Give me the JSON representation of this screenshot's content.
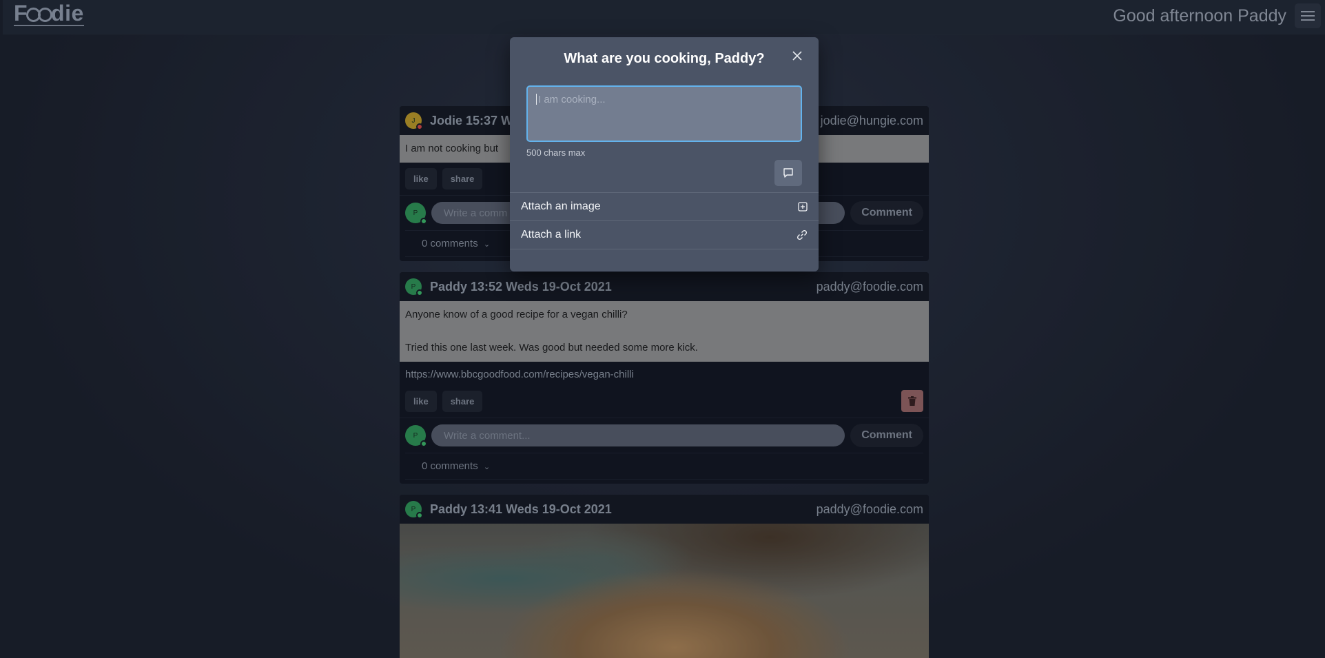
{
  "navbar": {
    "logo_text_start": "F",
    "logo_text_end": "die",
    "greeting": "Good afternoon Paddy"
  },
  "posts": [
    {
      "avatar_initial": "J",
      "avatar_color": "#c9a227",
      "status_color": "#e04848",
      "author_line": "Jodie 15:37 We",
      "email": "jodie@hungie.com",
      "body": "I am not cooking but",
      "like_label": "like",
      "share_label": "share",
      "commenter_initial": "P",
      "comment_placeholder": "Write a comm",
      "comment_button": "Comment",
      "comments_count": "0 comments"
    },
    {
      "avatar_initial": "P",
      "avatar_color": "#2f9e5a",
      "status_color": "#3fc46f",
      "author_line": "Paddy 13:52 Weds 19-Oct 2021",
      "email": "paddy@foodie.com",
      "body_line1": "Anyone know of a good recipe for a vegan chilli?",
      "body_line2": "Tried this one last week. Was good but needed some more kick.",
      "link": "https://www.bbcgoodfood.com/recipes/vegan-chilli",
      "like_label": "like",
      "share_label": "share",
      "commenter_initial": "P",
      "comment_placeholder": "Write a comment...",
      "comment_button": "Comment",
      "comments_count": "0 comments"
    },
    {
      "avatar_initial": "P",
      "avatar_color": "#2f9e5a",
      "status_color": "#3fc46f",
      "author_line": "Paddy 13:41 Weds 19-Oct 2021",
      "email": "paddy@foodie.com"
    }
  ],
  "modal": {
    "title": "What are you cooking, Paddy?",
    "textarea_placeholder": "I am cooking...",
    "chars_max": "500 chars max",
    "attach_image_label": "Attach an image",
    "attach_link_label": "Attach a link"
  },
  "colors": {
    "accent_focus": "#63b3ed",
    "delete": "#a06a6a"
  }
}
